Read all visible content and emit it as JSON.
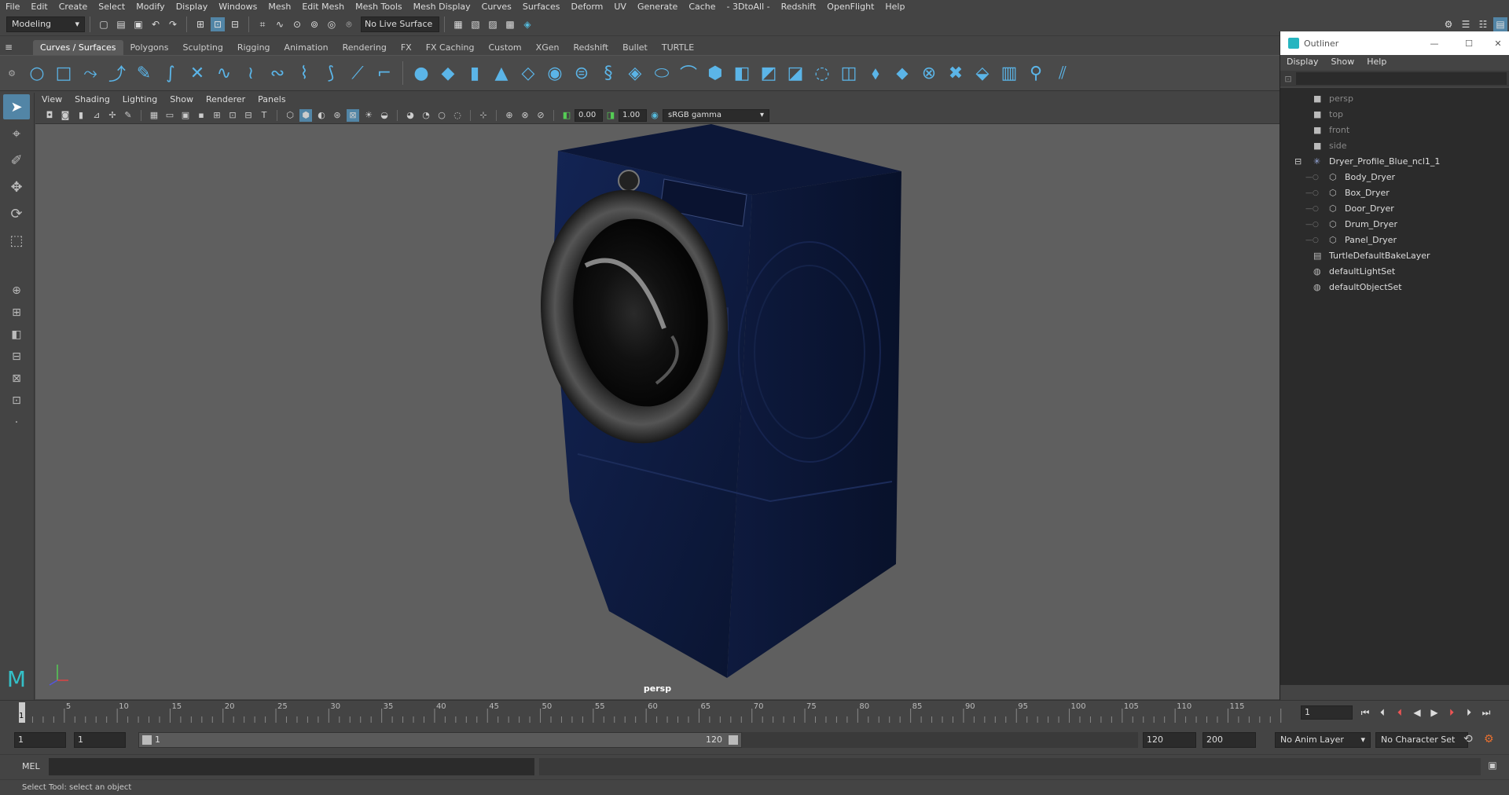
{
  "menubar": {
    "items": [
      "File",
      "Edit",
      "Create",
      "Select",
      "Modify",
      "Display",
      "Windows",
      "Mesh",
      "Edit Mesh",
      "Mesh Tools",
      "Mesh Display",
      "Curves",
      "Surfaces",
      "Deform",
      "UV",
      "Generate",
      "Cache",
      "- 3DtoAll -",
      "Redshift",
      "OpenFlight",
      "Help"
    ]
  },
  "statusline": {
    "mode": "Modeling",
    "live_surface": "No Live Surface"
  },
  "shelf": {
    "tabs": [
      "Curves / Surfaces",
      "Polygons",
      "Sculpting",
      "Rigging",
      "Animation",
      "Rendering",
      "FX",
      "FX Caching",
      "Custom",
      "XGen",
      "Redshift",
      "Bullet",
      "TURTLE"
    ],
    "active_tab": "Curves / Surfaces"
  },
  "viewport": {
    "menu": [
      "View",
      "Shading",
      "Lighting",
      "Show",
      "Renderer",
      "Panels"
    ],
    "exposure": "0.00",
    "gamma": "1.00",
    "colorspace": "sRGB gamma",
    "camera_label": "persp"
  },
  "outliner": {
    "title": "Outliner",
    "menu": [
      "Display",
      "Show",
      "Help"
    ],
    "items": [
      {
        "label": "persp",
        "indent": 0,
        "dim": true,
        "icon": "camera-icon"
      },
      {
        "label": "top",
        "indent": 0,
        "dim": true,
        "icon": "camera-icon"
      },
      {
        "label": "front",
        "indent": 0,
        "dim": true,
        "icon": "camera-icon"
      },
      {
        "label": "side",
        "indent": 0,
        "dim": true,
        "icon": "camera-icon"
      },
      {
        "label": "Dryer_Profile_Blue_ncl1_1",
        "indent": 0,
        "dim": false,
        "icon": "group-icon",
        "expanded": true
      },
      {
        "label": "Body_Dryer",
        "indent": 1,
        "dim": false,
        "icon": "mesh-icon"
      },
      {
        "label": "Box_Dryer",
        "indent": 1,
        "dim": false,
        "icon": "mesh-icon"
      },
      {
        "label": "Door_Dryer",
        "indent": 1,
        "dim": false,
        "icon": "mesh-icon"
      },
      {
        "label": "Drum_Dryer",
        "indent": 1,
        "dim": false,
        "icon": "mesh-icon"
      },
      {
        "label": "Panel_Dryer",
        "indent": 1,
        "dim": false,
        "icon": "mesh-icon"
      },
      {
        "label": "TurtleDefaultBakeLayer",
        "indent": 0,
        "dim": false,
        "icon": "layer-icon"
      },
      {
        "label": "defaultLightSet",
        "indent": 0,
        "dim": false,
        "icon": "set-icon"
      },
      {
        "label": "defaultObjectSet",
        "indent": 0,
        "dim": false,
        "icon": "set-icon"
      }
    ]
  },
  "timeslider": {
    "ticks": [
      "5",
      "10",
      "15",
      "20",
      "25",
      "30",
      "35",
      "40",
      "45",
      "50",
      "55",
      "60",
      "65",
      "70",
      "75",
      "80",
      "85",
      "90",
      "95",
      "100",
      "105",
      "110",
      "115"
    ],
    "current_frame_label": "1",
    "current_frame_field": "1"
  },
  "range": {
    "start_field": "1",
    "start_anim_field": "1",
    "range_start": "1",
    "range_end": "120",
    "end_field": "120",
    "end_anim_field": "200",
    "anim_layer": "No Anim Layer",
    "character_set": "No Character Set"
  },
  "cmdline": {
    "label": "MEL"
  },
  "helpline": {
    "text": "Select Tool: select an object"
  },
  "colors": {
    "accent": "#5bb5e8",
    "dryer": "#0d1a3d"
  }
}
